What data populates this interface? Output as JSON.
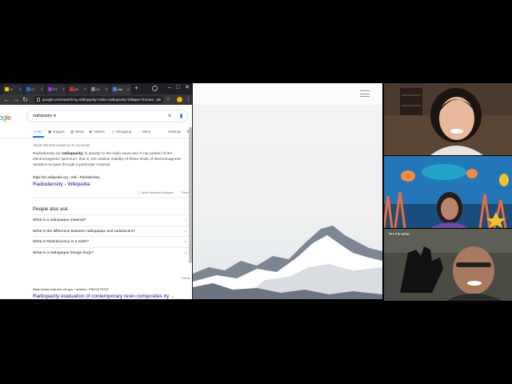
{
  "browser": {
    "tabs": [
      {
        "label": "Cl",
        "fav_color": "#fbbc04"
      },
      {
        "label": "Cl",
        "fav_color": "#1a73e8"
      },
      {
        "label": "GT",
        "fav_color": "#9334e6"
      },
      {
        "label": "(M",
        "fav_color": "#d93025"
      },
      {
        "label": "10",
        "fav_color": "#80868b"
      },
      {
        "label": "rad",
        "fav_color": "#4285f4"
      }
    ],
    "url": "google.com/search?q=radiopacity+radio+radiopacity+bilitape+chrome...&bih=708..."
  },
  "search": {
    "logo": [
      "o",
      "g",
      "le"
    ],
    "query": "radiopacity is",
    "tabs": [
      "All",
      "Images",
      "News",
      "Videos",
      "Shopping",
      "More",
      "Settings",
      "To"
    ],
    "stats": "About 326,000 results (0.41 seconds)",
    "snippet_pre": "Radiodensity (or ",
    "snippet_bold": "radiopacity",
    "snippet_post": ") is opacity to the radio wave and X-ray portion of the electromagnetic spectrum: that is, the relative inability of those kinds of electromagnetic radiation to pass through a particular material.",
    "cite": "https://en.wikipedia.org › wiki › Radiodensity",
    "wiki_title": "Radiodensity - Wikipedia",
    "about_snippets": "About featured snippets",
    "feedback": "Feedb",
    "paa_title": "People also ask",
    "paa": [
      "What is a radiopaque material?",
      "What is the difference between radiopaque and radiolucent?",
      "What is Radiolucency in a tooth?",
      "What is a radiopaque foreign body?"
    ],
    "paa_feedback": "Feedb",
    "r2_cite": "https://www.ncbi.nlm.nih.gov › articles › PMC4173732",
    "r2_title": "Radiopacity evaluation of contemporary resin composites by ..."
  },
  "video": {
    "tile2_name": "bnchiradac"
  }
}
